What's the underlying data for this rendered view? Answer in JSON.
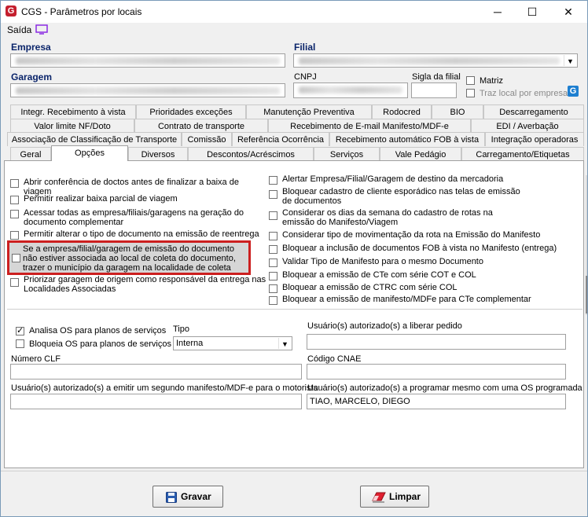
{
  "window": {
    "title": "CGS - Parâmetros por locais",
    "minimize": "─",
    "maximize": "☐",
    "close": "✕"
  },
  "menu": {
    "saida": "Saída"
  },
  "header": {
    "empresa_label": "Empresa",
    "filial_label": "Filial",
    "garagem_label": "Garagem",
    "cnpj_label": "CNPJ",
    "sigla_label": "Sigla da filial",
    "matriz_label": "Matriz",
    "traz_local_label": "Traz local por empresa",
    "g_badge": "G"
  },
  "tabs": {
    "row1": [
      "Integr. Recebimento à vista",
      "Prioridades exceções",
      "Manutenção Preventiva",
      "Rodocred",
      "BIO",
      "Descarregamento"
    ],
    "row2": [
      "Valor limite NF/Doto",
      "Contrato de transporte",
      "Recebimento de E-mail Manifesto/MDF-e",
      "EDI / Averbação"
    ],
    "row3": [
      "Associação de Classificação de Transporte",
      "Comissão",
      "Referência Ocorrência",
      "Recebimento automático FOB à vista",
      "Integração operadoras"
    ],
    "row4": [
      "Geral",
      "Opções",
      "Diversos",
      "Descontos/Acréscimos",
      "Serviços",
      "Vale Pedágio",
      "Carregamento/Etiquetas"
    ]
  },
  "options_left": [
    "Abrir conferência de doctos antes de finalizar a baixa de viagem",
    "Permitir realizar baixa parcial de viagem",
    "Acessar todas as empresa/filiais/garagens na geração do documento complementar",
    "Permitir alterar o tipo de documento na emissão de reentrega",
    "Se a empresa/filial/garagem de emissão do documento não estiver associada ao local de coleta do documento, trazer o município da garagem na localidade de coleta",
    "Priorizar garagem de origem como responsável da entrega nas Localidades Associadas"
  ],
  "options_right": [
    "Alertar Empresa/Filial/Garagem de destino da mercadoria",
    "Bloquear cadastro de cliente esporádico nas telas de emissão de documentos",
    "Considerar os dias da semana do cadastro de rotas na emissão do Manifesto/Viagem",
    "Considerar tipo de movimentação da rota na Emissão do Manifesto",
    "Bloquear a inclusão de documentos FOB à vista no Manifesto (entrega)",
    "Validar Tipo de Manifesto para o mesmo Documento",
    "Bloquear a emissão de CTe com série COT e COL",
    "Bloquear a emissão de CTRC com série COL",
    "Bloquear a emissão de manifesto/MDFe para CTe complementar"
  ],
  "lower": {
    "analisa_os": "Analisa OS para planos de serviços",
    "bloqueia_os": "Bloqueia OS para planos de serviços",
    "tipo_label": "Tipo",
    "tipo_value": "Interna",
    "usuarios_pedido_label": "Usuário(s) autorizado(s) a liberar pedido",
    "numero_clf_label": "Número CLF",
    "codigo_cnae_label": "Código CNAE",
    "usuarios_manifesto_label": "Usuário(s) autorizado(s) a emitir um segundo manifesto/MDF-e para o motorista",
    "usuarios_os_label": "Usuário(s) autorizado(s) a programar mesmo com uma OS programada",
    "usuarios_os_value": "TIAO, MARCELO, DIEGO"
  },
  "buttons": {
    "gravar": "Gravar",
    "limpar": "Limpar"
  },
  "colors": {
    "highlight": "#cc1f1f",
    "accent": "#0a246a",
    "brand": "#c41f2e"
  }
}
